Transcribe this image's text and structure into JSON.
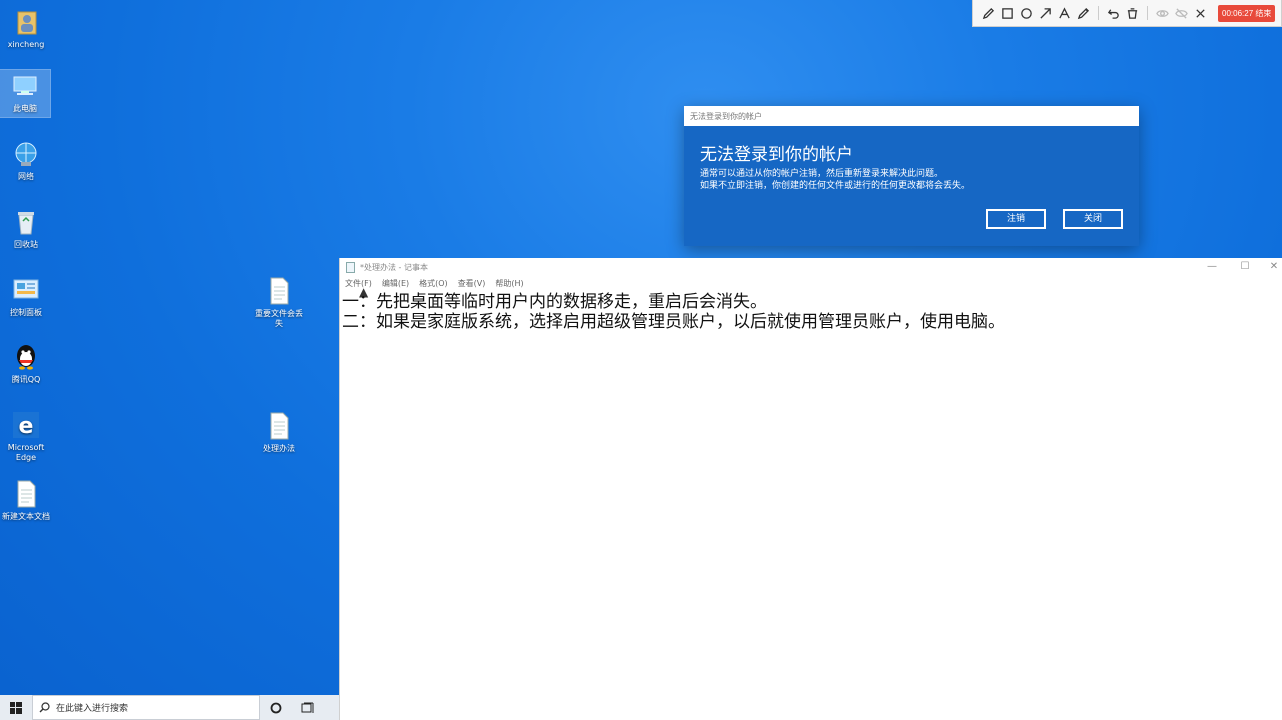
{
  "desktop": {
    "icons": [
      {
        "label": "xincheng",
        "icon": "user-folder-icon"
      },
      {
        "label": "此电脑",
        "icon": "this-pc-icon"
      },
      {
        "label": "网络",
        "icon": "network-icon"
      },
      {
        "label": "回收站",
        "icon": "recycle-bin-icon"
      },
      {
        "label": "控制面板",
        "icon": "control-panel-icon"
      },
      {
        "label": "腾讯QQ",
        "icon": "qq-icon"
      },
      {
        "label": "Microsoft Edge",
        "icon": "edge-icon"
      },
      {
        "label": "新建文本文档",
        "icon": "text-file-icon"
      },
      {
        "label": "重要文件会丢失",
        "icon": "text-file-icon"
      },
      {
        "label": "处理办法",
        "icon": "text-file-icon"
      }
    ]
  },
  "recorder": {
    "tools": [
      "pen-icon",
      "rectangle-icon",
      "circle-icon",
      "arrow-icon",
      "text-icon",
      "highlighter-icon",
      "undo-icon",
      "trash-icon",
      "eye-icon",
      "eye-off-icon",
      "close-icon"
    ],
    "timer": "00:06:27 结束",
    "timer_color": "#e84a3b"
  },
  "dialog": {
    "window_title": "无法登录到你的帐户",
    "heading": "无法登录到你的帐户",
    "message_line1": "通常可以通过从你的帐户注销，然后重新登录来解决此问题。",
    "message_line2": "如果不立即注销，你创建的任何文件或进行的任何更改都将会丢失。",
    "signout_label": "注销",
    "close_label": "关闭",
    "background": "#1667c4"
  },
  "notepad": {
    "title": "*处理办法 - 记事本",
    "menu": [
      "文件(F)",
      "编辑(E)",
      "格式(O)",
      "查看(V)",
      "帮助(H)"
    ],
    "line1": "一：先把桌面等临时用户内的数据移走，重启后会消失。",
    "line2": "二：如果是家庭版系统，选择启用超级管理员账户，以后就使用管理员账户，使用电脑。"
  },
  "taskbar": {
    "search_placeholder": "在此键入进行搜索"
  }
}
